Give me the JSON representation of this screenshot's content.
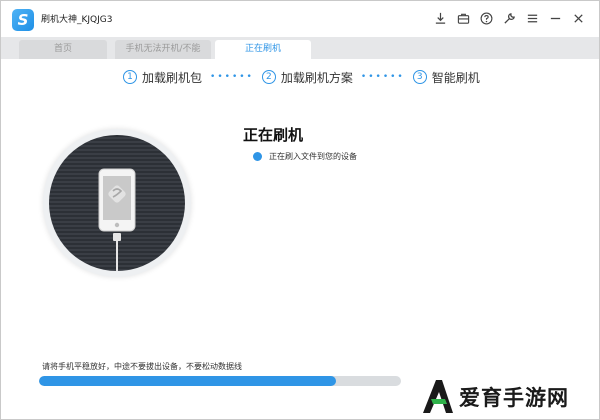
{
  "app": {
    "title": "刷机大神_KJQJG3",
    "logo_letter": "S"
  },
  "toolbar_icons": [
    "download-icon",
    "briefcase-icon",
    "help-icon",
    "wrench-icon",
    "menu-icon",
    "minimize-icon",
    "close-icon"
  ],
  "tabs": [
    {
      "label": "首页",
      "active": false
    },
    {
      "label": "手机无法开机/不能",
      "active": false
    },
    {
      "label": "正在刷机",
      "active": true
    }
  ],
  "steps": [
    {
      "num": "1",
      "label": "加载刷机包"
    },
    {
      "num": "2",
      "label": "加载刷机方案"
    },
    {
      "num": "3",
      "label": "智能刷机"
    }
  ],
  "step_separator": "••••••",
  "status": {
    "title": "正在刷机",
    "detail": "正在刷入文件到您的设备"
  },
  "warning": "请将手机平稳放好，中途不要拔出设备，不要松动数据线",
  "progress": 0.82,
  "watermark": {
    "text": "爱育手游网"
  },
  "colors": {
    "accent": "#2f95e6",
    "track": "#d9dcdf",
    "circle_dark": "#2c3036"
  }
}
